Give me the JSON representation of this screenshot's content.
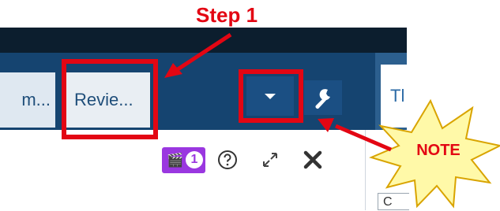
{
  "tabs": [
    {
      "label": "m..."
    },
    {
      "label": "Revie..."
    },
    {
      "label": "Tl"
    }
  ],
  "toolbar": {
    "dropdown_icon": "caret-down-icon",
    "settings_icon": "wrench-icon"
  },
  "panel_controls": {
    "media_badge_icon": "clapperboard-icon",
    "media_badge_count": "1",
    "help_icon": "question-circle-icon",
    "expand_icon": "expand-arrows-icon",
    "close_icon": "close-x-icon"
  },
  "side_field": {
    "value": "C"
  },
  "annotations": {
    "step_label": "Step 1",
    "note_label": "NOTE",
    "highlight_color": "#e30613",
    "note_burst_color": "#fff9a8"
  },
  "colors": {
    "tabbar": "#154470",
    "top_band": "#0c1e2e",
    "button": "#1b4f83",
    "media_badge": "#9a37e0"
  }
}
